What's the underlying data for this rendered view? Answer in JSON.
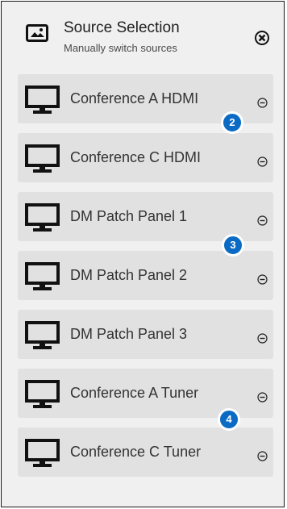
{
  "header": {
    "title": "Source Selection",
    "subtitle": "Manually switch sources",
    "image_icon": "image-icon",
    "close_icon": "close-circle-icon"
  },
  "sources": [
    {
      "label": "Conference A HDMI",
      "icon": "monitor-icon",
      "action_icon": "remove-circle-icon"
    },
    {
      "label": "Conference C HDMI",
      "icon": "monitor-icon",
      "action_icon": "remove-circle-icon"
    },
    {
      "label": "DM Patch Panel 1",
      "icon": "monitor-icon",
      "action_icon": "remove-circle-icon"
    },
    {
      "label": "DM Patch Panel 2",
      "icon": "monitor-icon",
      "action_icon": "remove-circle-icon"
    },
    {
      "label": "DM Patch Panel 3",
      "icon": "monitor-icon",
      "action_icon": "remove-circle-icon"
    },
    {
      "label": "Conference A Tuner",
      "icon": "monitor-icon",
      "action_icon": "remove-circle-icon"
    },
    {
      "label": "Conference C Tuner",
      "icon": "monitor-icon",
      "action_icon": "remove-circle-icon"
    }
  ],
  "badges": [
    "2",
    "3",
    "4"
  ],
  "colors": {
    "panel_bg": "#f0f0f0",
    "item_bg": "#e1e1e1",
    "badge_bg": "#0b6bc4",
    "text": "#333333"
  }
}
